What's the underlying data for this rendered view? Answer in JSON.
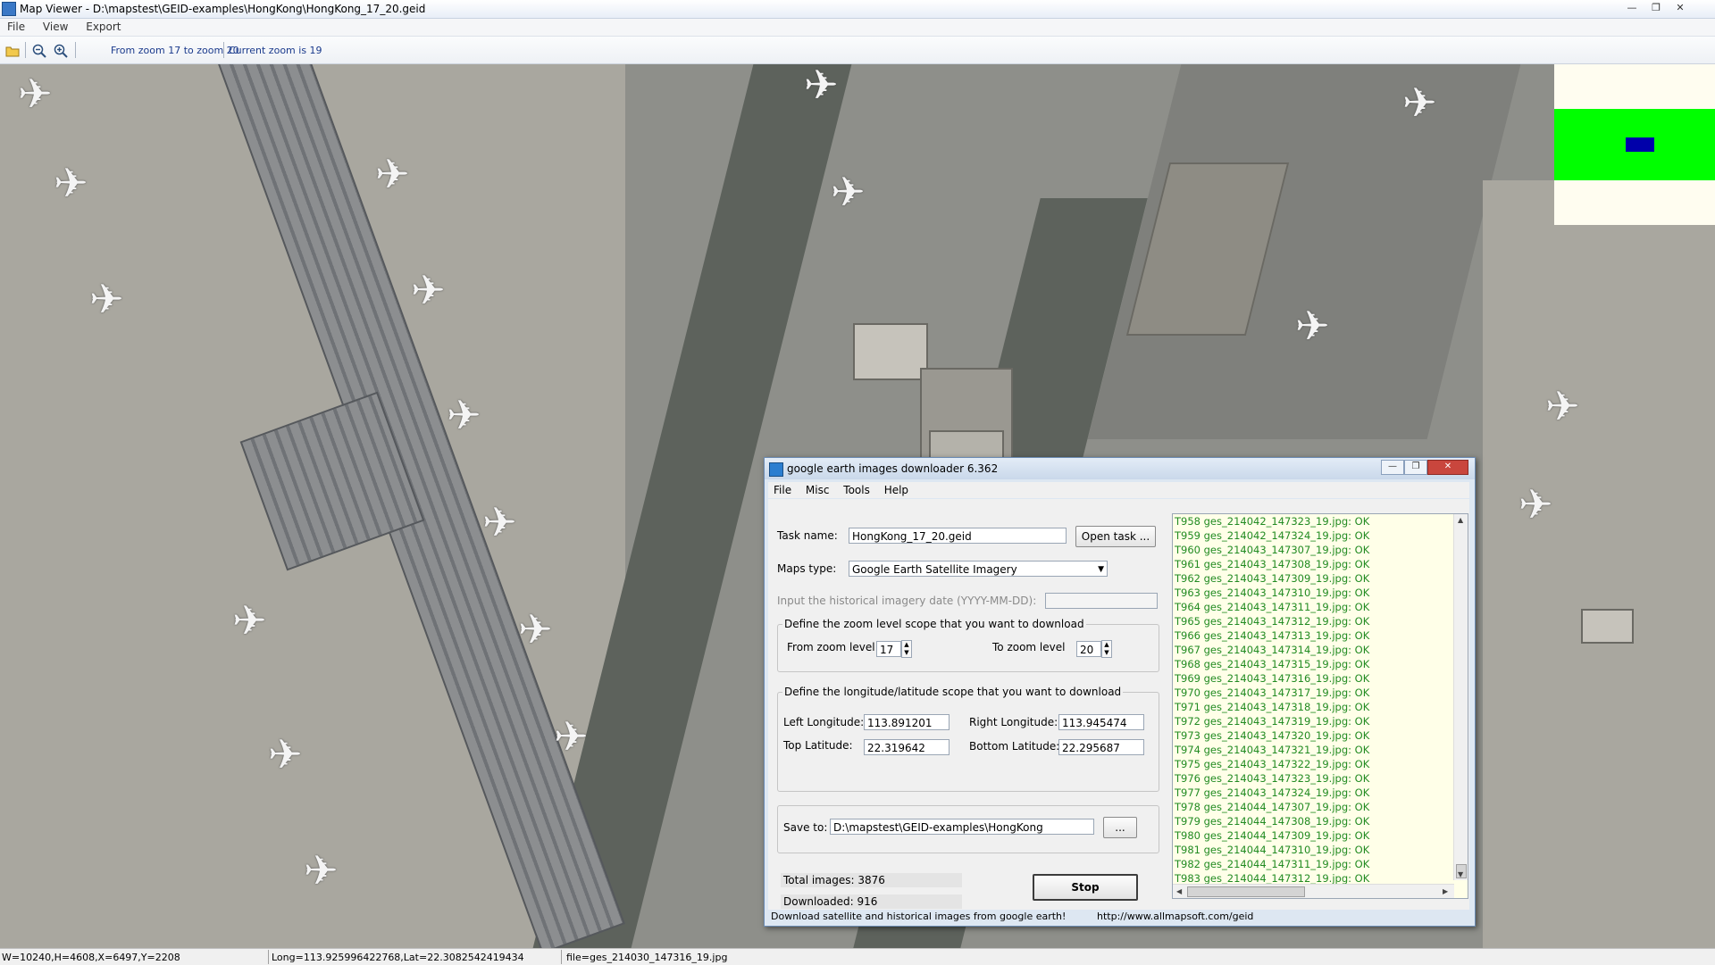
{
  "window": {
    "title": "Map Viewer - D:\\mapstest\\GEID-examples\\HongKong\\HongKong_17_20.geid",
    "minimize": "—",
    "restore": "❐",
    "close": "✕"
  },
  "menu": [
    "File",
    "View",
    "Export"
  ],
  "toolbar": {
    "open_icon": "folder-open-icon",
    "zoom_out_icon": "zoom-out-icon",
    "zoom_in_icon": "zoom-in-icon",
    "zoom_range": "From zoom 17 to zoom 20",
    "current_zoom": "Current zoom is 19"
  },
  "overview_colors": {
    "background": "#fffdf0",
    "covered": "#00ff00",
    "viewport": "#0000aa"
  },
  "statusbar": {
    "size": "W=10240,H=4608,X=6497,Y=2208",
    "coords": "Long=113.925996422768,Lat=22.3082542419434",
    "file": "file=ges_214030_147316_19.jpg"
  },
  "dialog": {
    "title": "google earth images downloader 6.362",
    "menu": [
      "File",
      "Misc",
      "Tools",
      "Help"
    ],
    "task_label": "Task name:",
    "task_value": "HongKong_17_20.geid",
    "open_task": "Open task ...",
    "maps_type_label": "Maps type:",
    "maps_type_value": "Google Earth Satellite Imagery",
    "hist_label": "Input the  historical imagery date (YYYY-MM-DD):",
    "hist_value": "",
    "zoom_group": "Define the zoom level scope that you want to download",
    "from_zoom_label": "From zoom level",
    "from_zoom": "17",
    "to_zoom_label": "To zoom level",
    "to_zoom": "20",
    "lonlat_group": "Define the longitude/latitude scope that you want to download",
    "left_lon_label": "Left Longitude:",
    "left_lon": "113.891201",
    "right_lon_label": "Right Longitude:",
    "right_lon": "113.945474",
    "top_lat_label": "Top Latitude:",
    "top_lat": "22.319642",
    "bottom_lat_label": "Bottom Latitude:",
    "bottom_lat": "22.295687",
    "save_label": "Save to:",
    "save_path": "D:\\mapstest\\GEID-examples\\HongKong",
    "browse": "...",
    "total": "Total images: 3876",
    "downloaded": "Downloaded: 916",
    "stop": "Stop",
    "footer_left": "Download satellite and historical  images from google earth!",
    "footer_right": "http://www.allmapsoft.com/geid",
    "log_color": "#228b22",
    "log": [
      "T958 ges_214042_147323_19.jpg:  OK",
      "T959 ges_214042_147324_19.jpg:  OK",
      "T960 ges_214043_147307_19.jpg:  OK",
      "T961 ges_214043_147308_19.jpg:  OK",
      "T962 ges_214043_147309_19.jpg:  OK",
      "T963 ges_214043_147310_19.jpg:  OK",
      "T964 ges_214043_147311_19.jpg:  OK",
      "T965 ges_214043_147312_19.jpg:  OK",
      "T966 ges_214043_147313_19.jpg:  OK",
      "T967 ges_214043_147314_19.jpg:  OK",
      "T968 ges_214043_147315_19.jpg:  OK",
      "T969 ges_214043_147316_19.jpg:  OK",
      "T970 ges_214043_147317_19.jpg:  OK",
      "T971 ges_214043_147318_19.jpg:  OK",
      "T972 ges_214043_147319_19.jpg:  OK",
      "T973 ges_214043_147320_19.jpg:  OK",
      "T974 ges_214043_147321_19.jpg:  OK",
      "T975 ges_214043_147322_19.jpg:  OK",
      "T976 ges_214043_147323_19.jpg:  OK",
      "T977 ges_214043_147324_19.jpg:  OK",
      "T978 ges_214044_147307_19.jpg:  OK",
      "T979 ges_214044_147308_19.jpg:  OK",
      "T980 ges_214044_147309_19.jpg:  OK",
      "T981 ges_214044_147310_19.jpg:  OK",
      "T982 ges_214044_147311_19.jpg:  OK",
      "T983 ges_214044_147312_19.jpg:  OK"
    ]
  }
}
